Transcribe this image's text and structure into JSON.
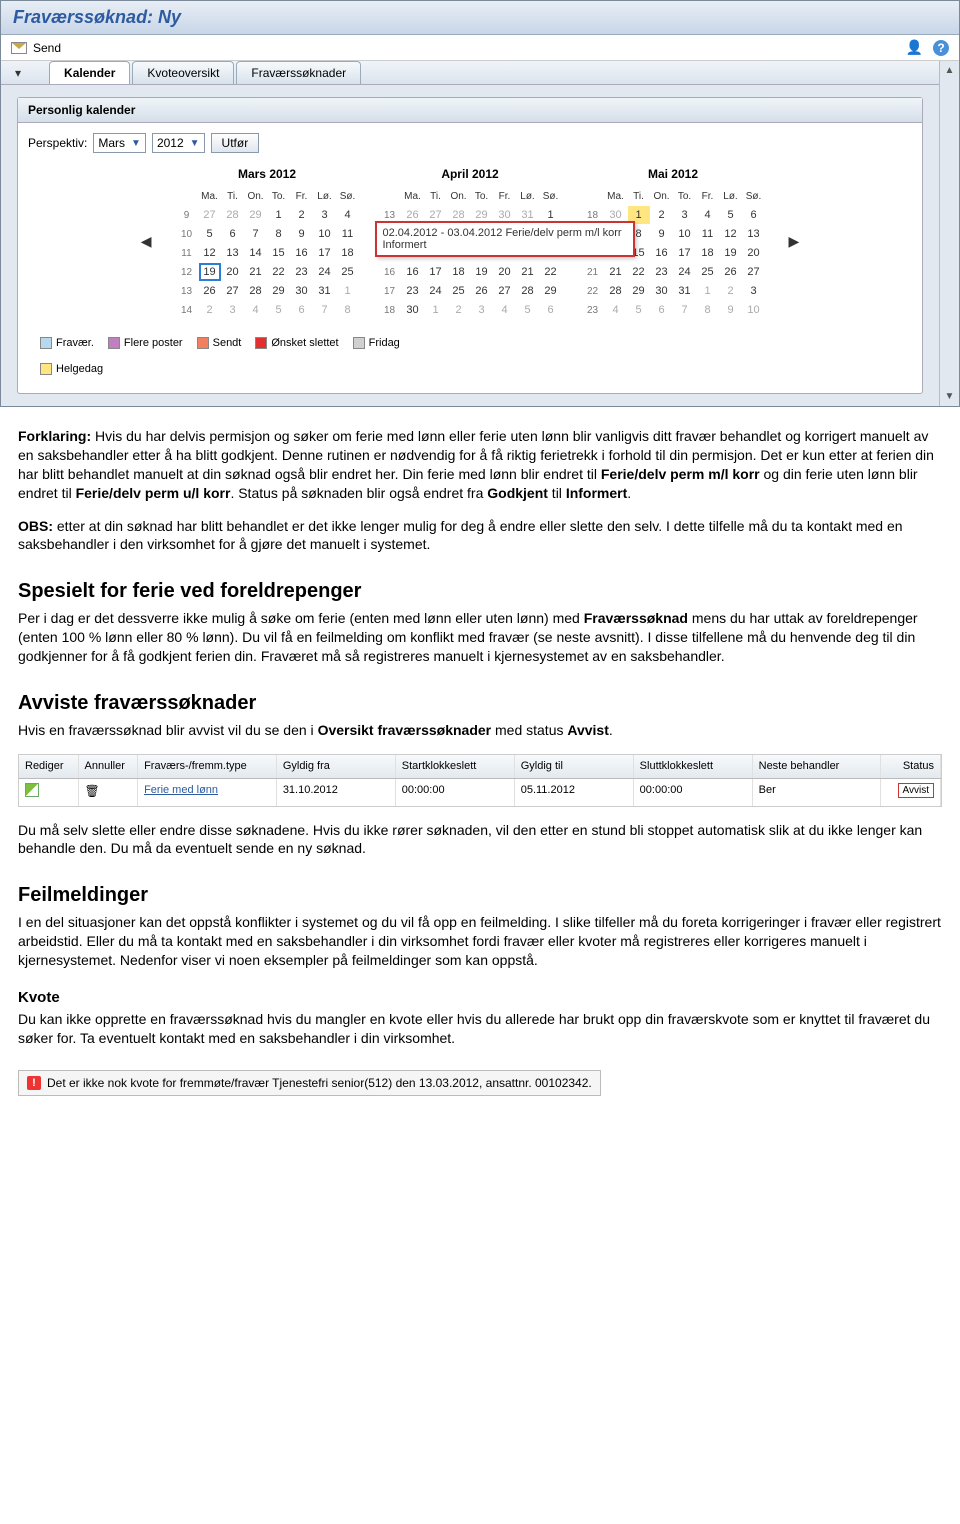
{
  "app": {
    "title": "Fraværssøknad: Ny",
    "send": "Send"
  },
  "tabs": {
    "t1": "Kalender",
    "t2": "Kvoteoversikt",
    "t3": "Fraværssøknader"
  },
  "panel": {
    "title": "Personlig kalender",
    "perspective_label": "Perspektiv:",
    "month": "Mars",
    "year": "2012",
    "execute": "Utfør"
  },
  "cal": {
    "headers": [
      "Ma.",
      "Ti.",
      "On.",
      "To.",
      "Fr.",
      "Lø.",
      "Sø."
    ],
    "m1_title": "Mars 2012",
    "m2_title": "April 2012",
    "m3_title": "Mai 2012",
    "tooltip_line1": "02.04.2012 - 03.04.2012 Ferie/delv perm m/l korr",
    "tooltip_line2": "Informert"
  },
  "legend": {
    "fravaer": "Fravær.",
    "flere": "Flere poster",
    "sendt": "Sendt",
    "onsket": "Ønsket slettet",
    "fridag": "Fridag",
    "helgedag": "Helgedag"
  },
  "doc": {
    "forklaring_label": "Forklaring:",
    "forklaring_body": " Hvis du har delvis permisjon og søker om ferie med lønn eller ferie uten lønn blir vanligvis ditt fravær behandlet og korrigert manuelt av en saksbehandler etter å ha blitt godkjent. Denne rutinen er nødvendig for å få riktig ferietrekk i forhold til din permisjon. Det er kun etter at ferien din har blitt behandlet manuelt at din søknad også blir endret her. Din ferie med lønn blir endret til ",
    "ferie_ml": "Ferie/delv perm m/l korr",
    "forklaring_mid": " og din ferie uten lønn blir endret til ",
    "ferie_ul": "Ferie/delv perm u/l korr",
    "forklaring_tail1": ". Status på søknaden blir også endret fra ",
    "godkjent": "Godkjent",
    "til": " til ",
    "informert": "Informert",
    "forklaring_tail2": ".",
    "obs_label": "OBS:",
    "obs_body": " etter at din søknad har blitt behandlet er det ikke lenger mulig for deg å endre eller slette den selv. I dette tilfelle må du ta kontakt med en saksbehandler i den virksomhet for å gjøre det manuelt i systemet.",
    "h_spesielt": "Spesielt for ferie ved foreldrepenger",
    "spesielt_body_1": "Per i dag er det dessverre ikke mulig å søke om ferie (enten med lønn eller uten lønn) med ",
    "spesielt_bold": "Fraværssøknad",
    "spesielt_body_2": " mens du har uttak av foreldrepenger (enten 100 % lønn eller 80 % lønn). Du vil få en feilmelding om konflikt med fravær (se neste avsnitt). I disse tilfellene må du henvende deg til din godkjenner for å få godkjent ferien din. Fraværet må så registreres manuelt i kjernesystemet av en saksbehandler.",
    "h_avviste": "Avviste fraværssøknader",
    "avviste_body_1": "Hvis en fraværssøknad blir avvist vil du se den i ",
    "avviste_bold1": "Oversikt fraværssøknader",
    "avviste_mid": " med status ",
    "avviste_bold2": "Avvist",
    "avviste_tail": ".",
    "avviste_p2": "Du må selv slette eller endre disse søknadene.  Hvis du ikke rører søknaden, vil den etter en stund bli stoppet automatisk slik at du ikke lenger kan behandle den. Du må da eventuelt sende en ny søknad.",
    "h_feil": "Feilmeldinger",
    "feil_body": "I en del situasjoner kan det oppstå konflikter i systemet og du vil få opp en feilmelding. I slike tilfeller må du foreta korrigeringer i fravær eller registrert arbeidstid. Eller du må ta kontakt med en saksbehandler i din virksomhet fordi fravær eller kvoter må registreres eller korrigeres manuelt i kjernesystemet. Nedenfor viser vi noen eksempler på feilmeldinger som kan oppstå.",
    "h_kvote": "Kvote",
    "kvote_body": "Du kan ikke opprette en fraværssøknad hvis du mangler en kvote eller hvis du allerede har brukt opp din fraværskvote som er knyttet til fraværet du søker for. Ta eventuelt kontakt med en saksbehandler i din virksomhet.",
    "error_msg": "Det er ikke nok kvote for fremmøte/fravær Tjenestefri senior(512) den 13.03.2012, ansattnr. 00102342."
  },
  "table": {
    "h_edit": "Rediger",
    "h_ann": "Annuller",
    "h_type": "Fraværs-/fremm.type",
    "h_from": "Gyldig fra",
    "h_start": "Startklokkeslett",
    "h_to": "Gyldig til",
    "h_end": "Sluttklokkeslett",
    "h_next": "Neste behandler",
    "h_stat": "Status",
    "r_type": "Ferie med lønn",
    "r_from": "31.10.2012",
    "r_start": "00:00:00",
    "r_to": "05.11.2012",
    "r_end": "00:00:00",
    "r_next": "Ber",
    "r_stat": "Avvist"
  }
}
